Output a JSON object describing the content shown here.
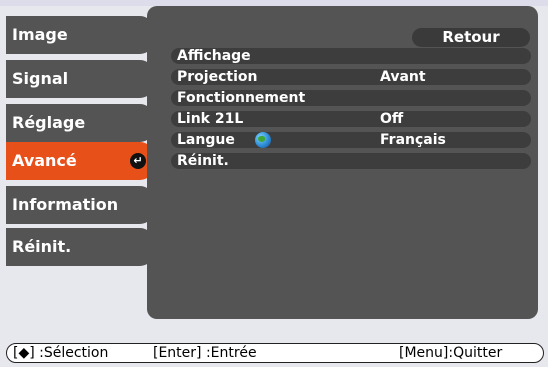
{
  "sidebar": {
    "items": [
      {
        "label": "Image",
        "active": false
      },
      {
        "label": "Signal",
        "active": false
      },
      {
        "label": "Réglage",
        "active": false
      },
      {
        "label": "Avancé",
        "active": true
      },
      {
        "label": "Information",
        "active": false
      },
      {
        "label": "Réinit.",
        "active": false
      }
    ],
    "enter_symbol": "↵"
  },
  "panel": {
    "back_label": "Retour",
    "rows": [
      {
        "label": "Affichage",
        "value": ""
      },
      {
        "label": "Projection",
        "value": "Avant"
      },
      {
        "label": "Fonctionnement",
        "value": ""
      },
      {
        "label": "Link 21L",
        "value": "Off"
      },
      {
        "label": "Langue",
        "value": "Français",
        "icon": "globe-icon"
      },
      {
        "label": "Réinit.",
        "value": ""
      }
    ]
  },
  "footer": {
    "select_hint": "[◆] :Sélection",
    "enter_hint": "[Enter] :Entrée",
    "menu_hint": "[Menu]:Quitter"
  },
  "colors": {
    "active": "#e8501a",
    "item_bg": "#545454",
    "page_bg": "#e7e7ee"
  }
}
